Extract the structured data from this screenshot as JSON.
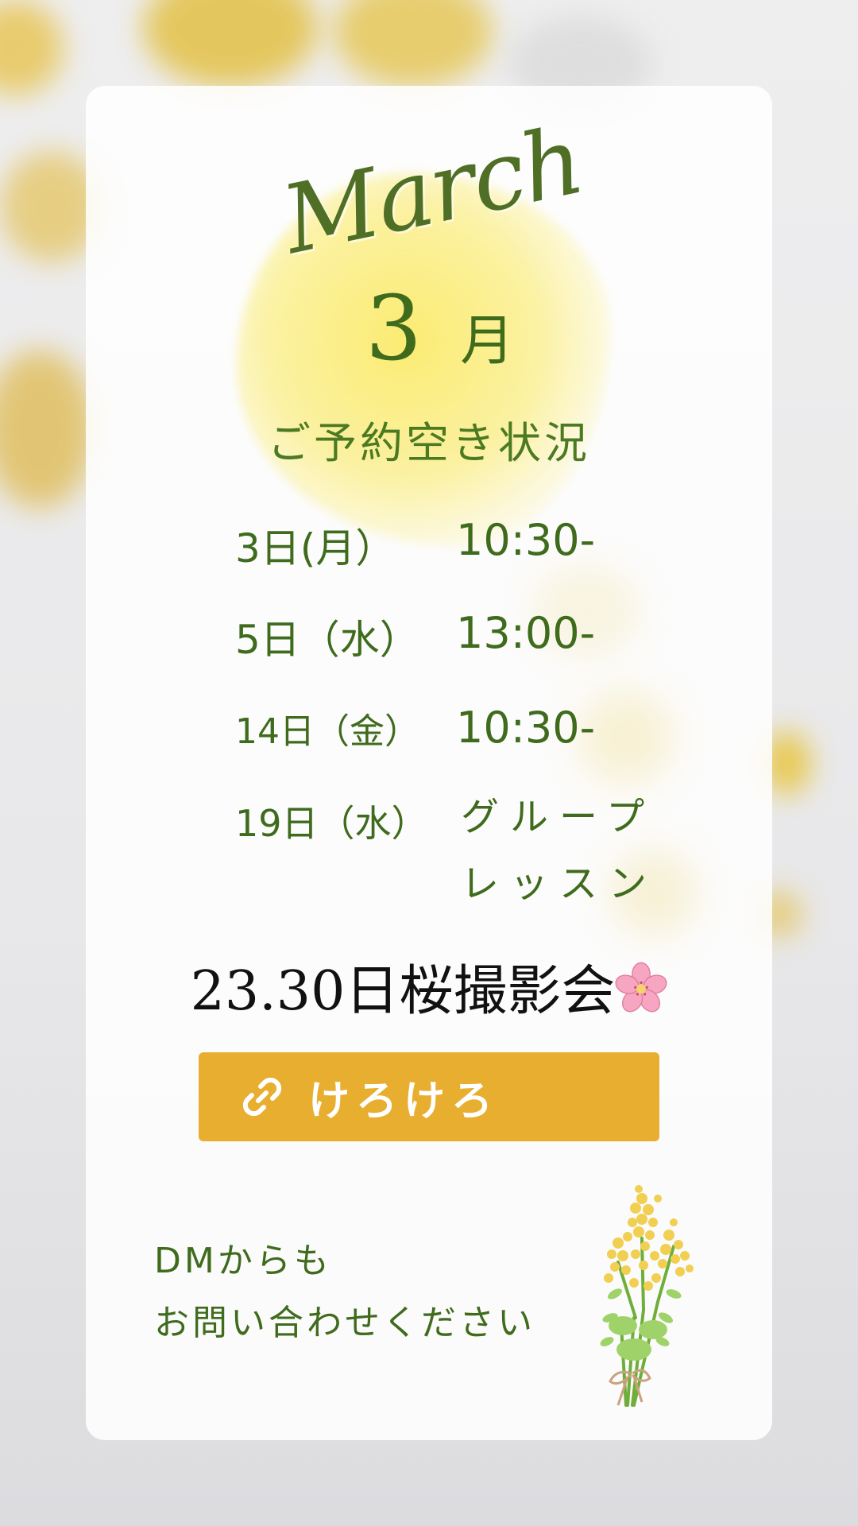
{
  "header": {
    "script_title": "March",
    "month_number": "3",
    "month_suffix": "月",
    "subtitle": "ご予約空き状況"
  },
  "schedule": [
    {
      "day": "3日(月）",
      "time": "10:30-"
    },
    {
      "day": "5日（水）",
      "time": "13:00-"
    },
    {
      "day": "14日（金）",
      "time": "10:30-"
    },
    {
      "day": "19日（水）",
      "time_line1": "グループ",
      "time_line2": "レッスン"
    }
  ],
  "special_event": {
    "text": "23.30日桜撮影会",
    "icon": "cherry-blossom-icon"
  },
  "link_button": {
    "label": "けろけろ",
    "icon": "link-icon",
    "color": "#e8ae30"
  },
  "contact": {
    "line1": "DMからも",
    "line2": "お問い合わせください"
  },
  "decorations": {
    "bouquet_icon": "mimosa-bouquet-icon"
  },
  "colors": {
    "text_green": "#3f6b1d",
    "accent_yellow": "#e8ae30"
  }
}
